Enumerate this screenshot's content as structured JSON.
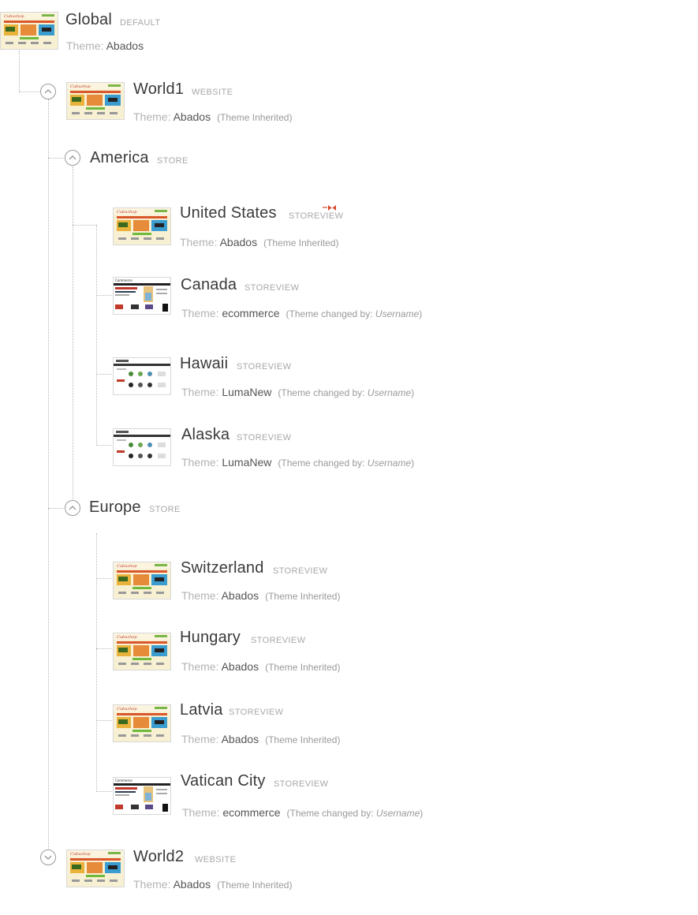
{
  "theme_label": "Theme:",
  "inherited_note": "(Theme Inherited)",
  "changed_by_prefix": "(Theme changed by:",
  "changed_by_user": "Username",
  "changed_by_suffix": ")",
  "nodes": [
    {
      "name": "Global",
      "type": "DEFAULT",
      "theme": "Abados",
      "thumb": "abados"
    },
    {
      "name": "World1",
      "type": "WEBSITE",
      "theme": "Abados",
      "thumb": "abados",
      "toggle": "collapse"
    },
    {
      "name": "America",
      "type": "STORE",
      "toggle": "collapse"
    },
    {
      "name": "United States",
      "type": "STOREVIEW",
      "theme": "Abados",
      "thumb": "abados",
      "badge": "default-storeview"
    },
    {
      "name": "Canada",
      "type": "STOREVIEW",
      "theme": "ecommerce",
      "thumb": "ecommerce"
    },
    {
      "name": "Hawaii",
      "type": "STOREVIEW",
      "theme": "LumaNew",
      "thumb": "luma"
    },
    {
      "name": "Alaska",
      "type": "STOREVIEW",
      "theme": "LumaNew",
      "thumb": "luma"
    },
    {
      "name": "Europe",
      "type": "STORE",
      "toggle": "collapse"
    },
    {
      "name": "Switzerland",
      "type": "STOREVIEW",
      "theme": "Abados",
      "thumb": "abados"
    },
    {
      "name": "Hungary",
      "type": "STOREVIEW",
      "theme": "Abados",
      "thumb": "abados"
    },
    {
      "name": "Latvia",
      "type": "STOREVIEW",
      "theme": "Abados",
      "thumb": "abados"
    },
    {
      "name": "Vatican City",
      "type": "STOREVIEW",
      "theme": "ecommerce",
      "thumb": "ecommerce"
    },
    {
      "name": "World2",
      "type": "WEBSITE",
      "theme": "Abados",
      "thumb": "abados",
      "toggle": "expand"
    }
  ],
  "colors": {
    "line": "#b8b8b8",
    "name": "#3a3a3a",
    "type": "#a8a8a8",
    "badge": "#d9462b"
  }
}
